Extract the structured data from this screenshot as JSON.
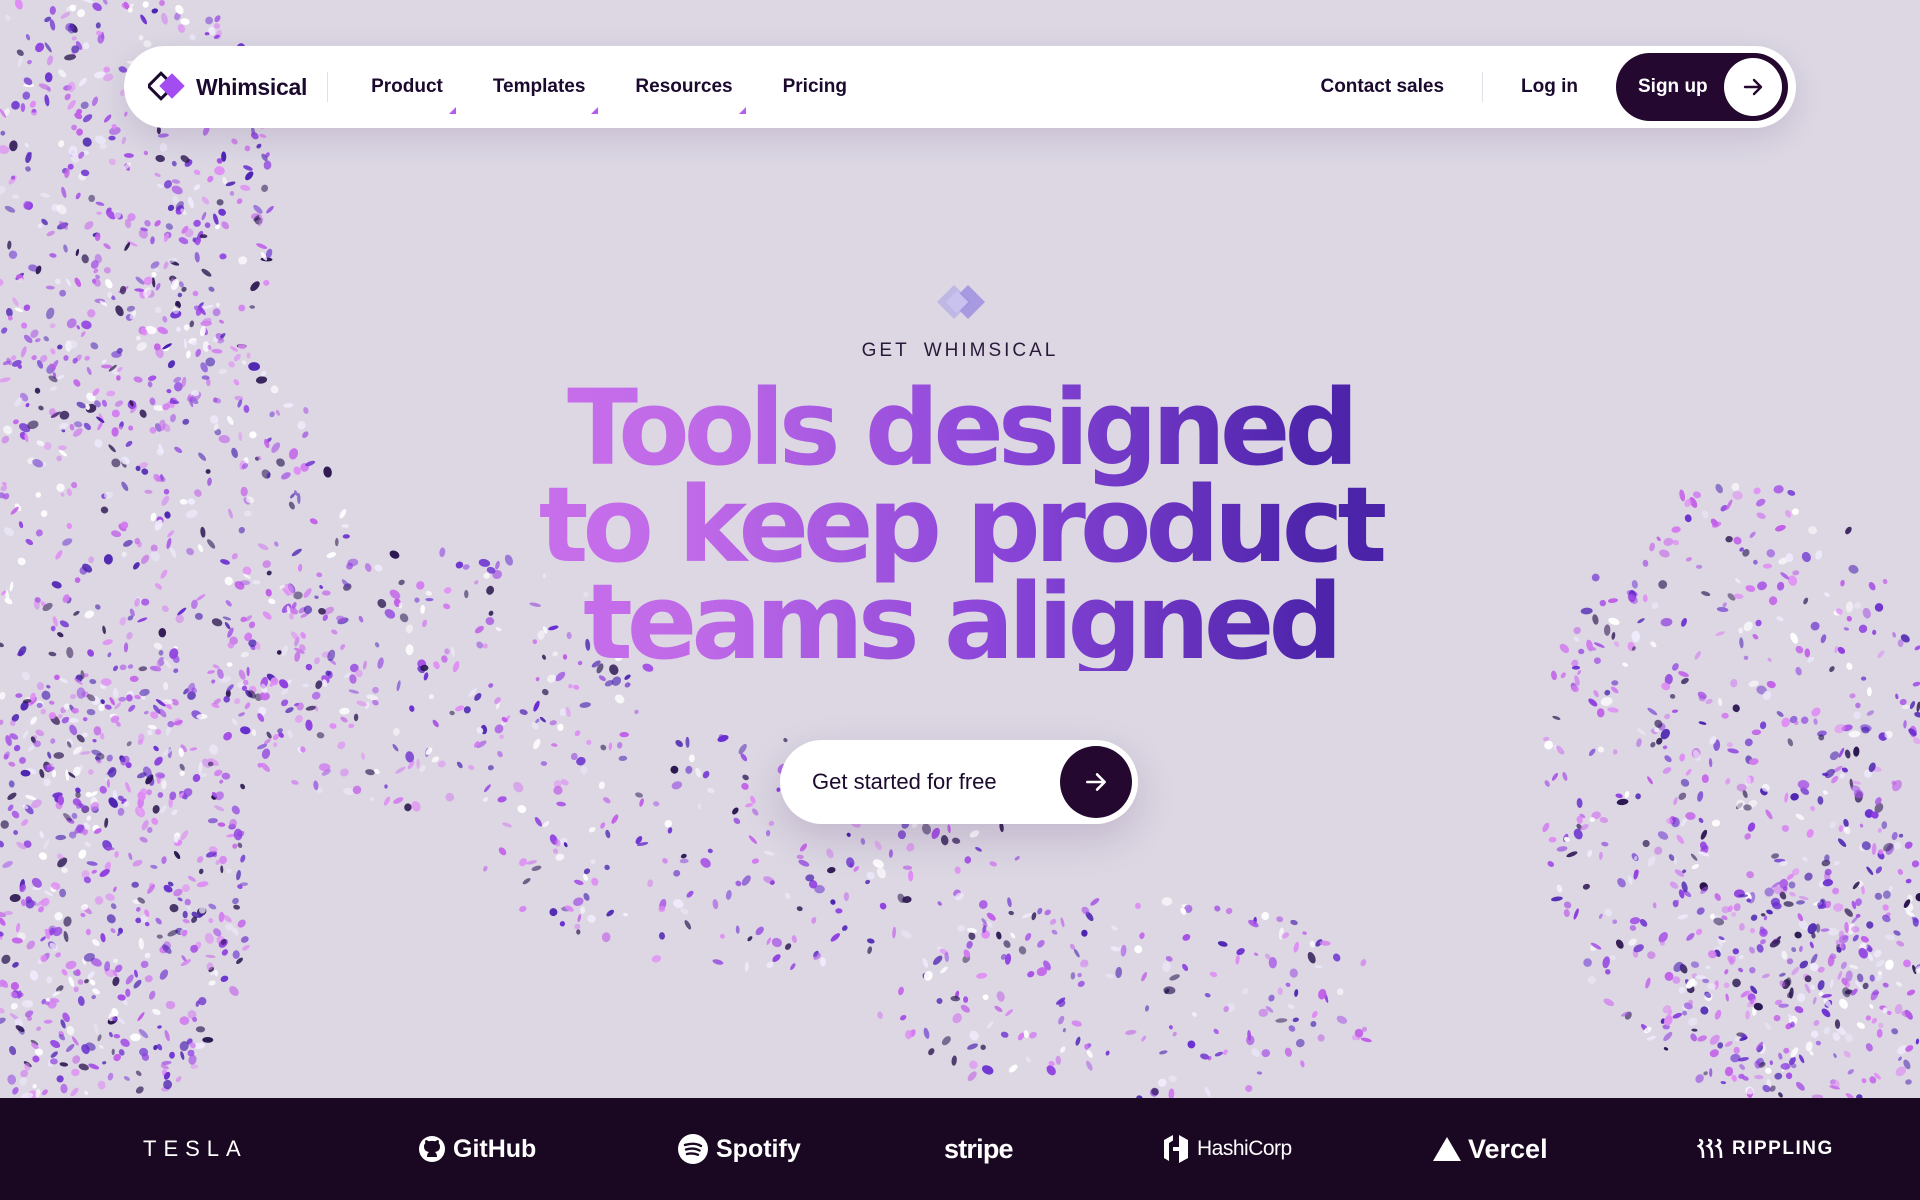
{
  "nav": {
    "brand": "Whimsical",
    "links": [
      {
        "label": "Product",
        "dropdown": true
      },
      {
        "label": "Templates",
        "dropdown": true
      },
      {
        "label": "Resources",
        "dropdown": true
      },
      {
        "label": "Pricing",
        "dropdown": false
      }
    ],
    "contact_sales": "Contact sales",
    "login": "Log in",
    "signup": "Sign up",
    "signup_icon": "arrow-right-icon"
  },
  "hero": {
    "eyebrow_word1": "GET",
    "eyebrow_word2": "WHIMSICAL",
    "headline": [
      "Tools designed",
      "to keep product",
      "teams aligned"
    ],
    "cta_label": "Get started for free",
    "cta_icon": "arrow-right-icon"
  },
  "logos": [
    "TESLA",
    "GitHub",
    "Spotify",
    "stripe",
    "HashiCorp",
    "Vercel",
    "RIPPLING"
  ],
  "colors": {
    "background": "#dcd7e3",
    "dark": "#24082f",
    "logo_bar": "#1a0722",
    "accent_pink": "#e27cf6",
    "accent_indigo": "#2a148a",
    "caret": "#b45cf0"
  }
}
